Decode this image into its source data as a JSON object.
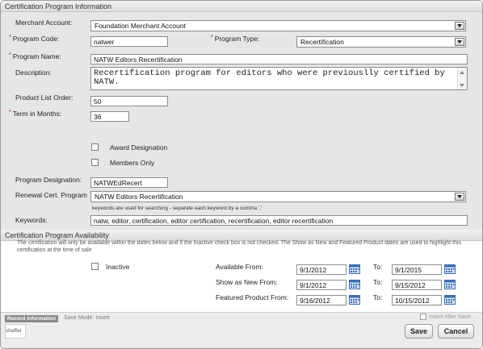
{
  "section_title": "Certification Program Information",
  "merchant_account": {
    "label": "Merchant Account:",
    "value": "Foundation Merchant Account"
  },
  "program_code": {
    "label": "Program Code:",
    "value": "natwer"
  },
  "program_type": {
    "label": "Program Type:",
    "value": "Recertification"
  },
  "program_name": {
    "label": "Program Name:",
    "value": "NATW Editors Recertification"
  },
  "description": {
    "label": "Description:",
    "value": "Recertification program for editors who were previouslly certified by NATW."
  },
  "product_list_order": {
    "label": "Product List Order:",
    "value": "50"
  },
  "term_in_months": {
    "label": "Term in Months:",
    "value": "36"
  },
  "award_designation": {
    "label": "Award Designation",
    "checked": false
  },
  "members_only": {
    "label": "Members Only",
    "checked": false
  },
  "program_designation": {
    "label": "Program Designation:",
    "value": "NATWEdRecert"
  },
  "renewal_cert_program": {
    "label": "Renewal Cert. Program",
    "value": "NATW Editors Recertification"
  },
  "keywords": {
    "hint": "keywords are used for searching - separate each keyword by a comma ','",
    "label": "Keywords:",
    "value": "natw, editor, certification, editor certification, recertification, editor recertification"
  },
  "availability": {
    "title": "Certification Program Availability",
    "notice": "The certification will only be available within the dates below and if the Inactive check box is not checked. The Show as New and Featured Product dates are used to highlight this certification at the time of sale",
    "inactive": {
      "label": "Inactive",
      "checked": false
    },
    "to_label": "To:",
    "available_from": {
      "label": "Available From:",
      "from": "9/1/2012",
      "to": "9/1/2015"
    },
    "show_as_new_from": {
      "label": "Show as New From:",
      "from": "9/1/2012",
      "to": "9/15/2012"
    },
    "featured_product_from": {
      "label": "Featured Product From:",
      "from": "9/16/2012",
      "to": "10/15/2012"
    }
  },
  "footer": {
    "record_information": "Record Information",
    "save_mode": "Save Mode: Insert",
    "user": "shaffer",
    "insert_after_save": "Insert After Save",
    "save_label": "Save",
    "cancel_label": "Cancel"
  },
  "colors": {
    "required_marker": "#c00000",
    "calendar_icon": "#3a6fb0"
  }
}
